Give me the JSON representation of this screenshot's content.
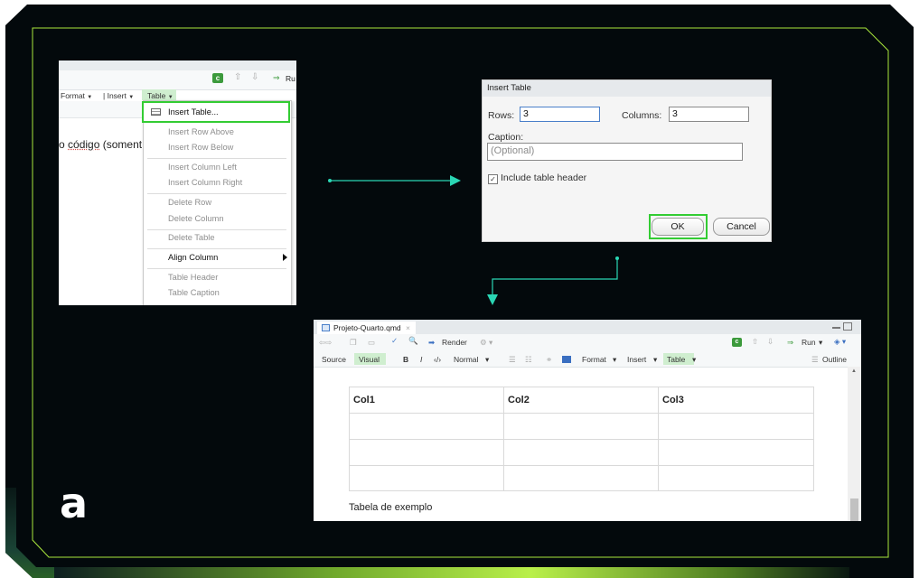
{
  "colors": {
    "frame_bg": "#03090c",
    "accent_green": "#a8e63c",
    "teal_arrow": "#2ad6b4",
    "highlight_green": "#33cc33",
    "visual_btn_green": "#cfeecf"
  },
  "logo": {
    "glyph": "a"
  },
  "shot1": {
    "menubar": {
      "format": "Format",
      "insert": "Insert",
      "table": "Table",
      "run": "Ru"
    },
    "doc_text_plain": "o ",
    "doc_text_underlined": "código",
    "doc_text_rest": " (soment",
    "menu": {
      "insert_table": "Insert Table...",
      "insert_row_above": "Insert Row Above",
      "insert_row_below": "Insert Row Below",
      "insert_column_left": "Insert Column Left",
      "insert_column_right": "Insert Column Right",
      "delete_row": "Delete Row",
      "delete_column": "Delete Column",
      "delete_table": "Delete Table",
      "align_column": "Align Column",
      "table_header": "Table Header",
      "table_caption": "Table Caption"
    }
  },
  "dialog": {
    "title": "Insert Table",
    "rows_label": "Rows:",
    "rows_value": "3",
    "columns_label": "Columns:",
    "columns_value": "3",
    "caption_label": "Caption:",
    "caption_placeholder": "(Optional)",
    "include_header_label": "Include table header",
    "include_header_checked": true,
    "ok_label": "OK",
    "cancel_label": "Cancel"
  },
  "shot3": {
    "tab_title": "Projeto-Quarto.qmd",
    "toolbar": {
      "render": "Render",
      "run": "Run",
      "source": "Source",
      "visual": "Visual",
      "bold": "B",
      "italic": "I",
      "code": "‹/›",
      "normal": "Normal",
      "format": "Format",
      "insert": "Insert",
      "table": "Table",
      "outline": "Outline"
    },
    "table": {
      "headers": [
        "Col1",
        "Col2",
        "Col3"
      ],
      "rows": [
        [
          "",
          "",
          ""
        ],
        [
          "",
          "",
          ""
        ],
        [
          "",
          "",
          ""
        ]
      ]
    },
    "caption": "Tabela de exemplo"
  }
}
